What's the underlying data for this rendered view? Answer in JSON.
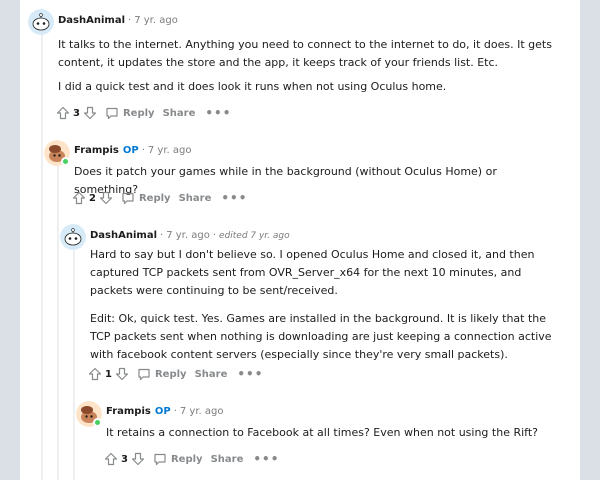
{
  "comments": [
    {
      "author": "DashAnimal",
      "op_badge": "",
      "time": "7 yr. ago",
      "edited": "",
      "paragraphs": [
        "It talks to the internet. Anything you need to connect to the internet to do, it does. It gets content, it updates the store and the app, it keeps track of your friends list. Etc.",
        "I did a quick test and it does look it runs when not using Oculus home."
      ],
      "score": "3",
      "reply_label": "Reply",
      "share_label": "Share",
      "more_label": "•••"
    },
    {
      "author": "Frampis",
      "op_badge": "OP",
      "time": "7 yr. ago",
      "edited": "",
      "paragraphs": [
        "Does it patch your games while in the background (without Oculus Home) or something?"
      ],
      "score": "2",
      "reply_label": "Reply",
      "share_label": "Share",
      "more_label": "•••"
    },
    {
      "author": "DashAnimal",
      "op_badge": "",
      "time": "7 yr. ago",
      "edited": "edited 7 yr. ago",
      "paragraphs": [
        "Hard to say but I don't believe so. I opened Oculus Home and closed it, and then captured TCP packets sent from OVR_Server_x64 for the next 10 minutes, and packets were continuing to be sent/received.",
        "Edit: Ok, quick test. Yes. Games are installed in the background. It is likely that the TCP packets sent when nothing is downloading are just keeping a connection active with facebook content servers (especially since they're very small packets)."
      ],
      "score": "1",
      "reply_label": "Reply",
      "share_label": "Share",
      "more_label": "•••"
    },
    {
      "author": "Frampis",
      "op_badge": "OP",
      "time": "7 yr. ago",
      "edited": "",
      "paragraphs": [
        "It retains a connection to Facebook at all times? Even when not using the Rift?"
      ],
      "score": "3",
      "reply_label": "Reply",
      "share_label": "Share",
      "more_label": "•••"
    }
  ],
  "meta_separator": "·",
  "colors": {
    "background": "#dae0e6",
    "card": "#ffffff",
    "op_blue": "#0079d3",
    "online_green": "#46d160",
    "muted": "#878a8c"
  }
}
